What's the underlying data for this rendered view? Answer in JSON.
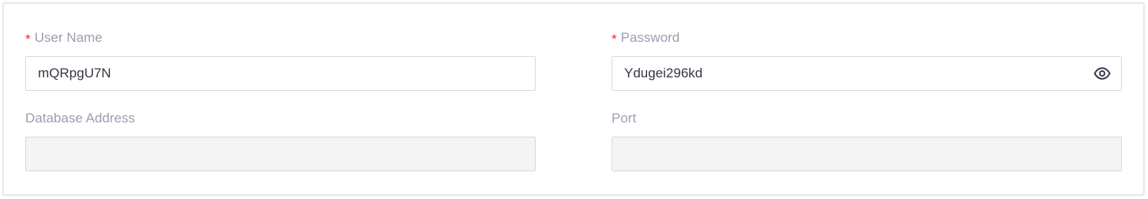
{
  "form": {
    "username": {
      "label": "User Name",
      "required_mark": "*",
      "value": "mQRpgU7N"
    },
    "password": {
      "label": "Password",
      "required_mark": "*",
      "value": "Ydugei296kd",
      "toggle_icon": "eye-icon"
    },
    "database_address": {
      "label": "Database Address",
      "value": ""
    },
    "port": {
      "label": "Port",
      "value": ""
    }
  },
  "colors": {
    "required": "#f5222d",
    "label": "#9a9fb0",
    "input_text": "#333740",
    "disabled_bg": "#f4f4f4",
    "border": "#d9d9d9"
  }
}
